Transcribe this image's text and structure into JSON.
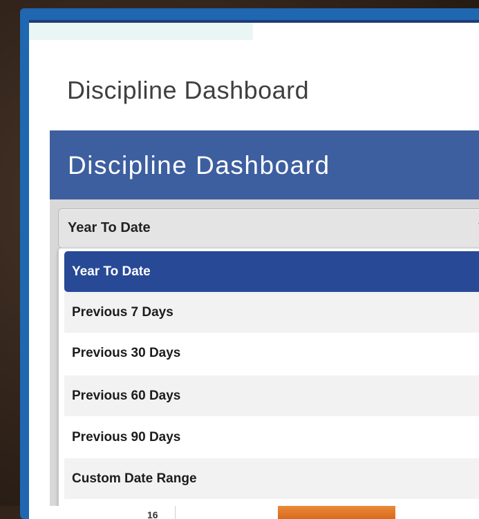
{
  "page": {
    "title": "Discipline Dashboard"
  },
  "banner": {
    "title": "Discipline Dashboard"
  },
  "date_filter": {
    "selected": "Year To Date",
    "options": [
      "Year To Date",
      "Previous 7 Days",
      "Previous 30 Days",
      "Previous 60 Days",
      "Previous 90 Days",
      "Custom Date Range"
    ]
  },
  "partial_table": {
    "visible_value": "16"
  },
  "colors": {
    "banner": "#3d5fa0",
    "selected_option": "#284996",
    "device_frame": "#1f67b1",
    "bar": "#e07a29"
  }
}
